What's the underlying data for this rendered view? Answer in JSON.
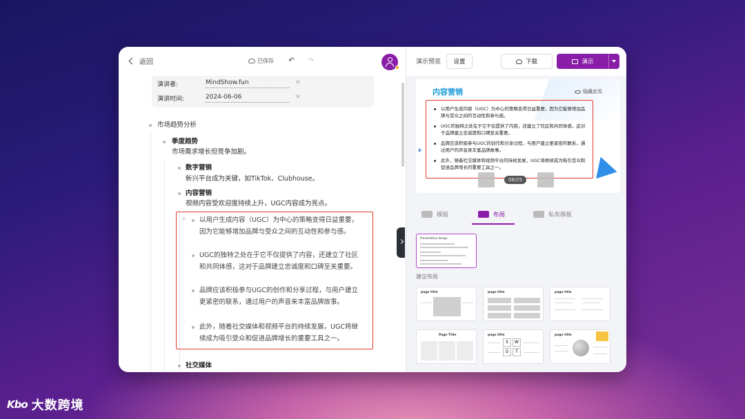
{
  "topbar": {
    "back_label": "返回",
    "saved_label": "已保存"
  },
  "meta": {
    "presenter_key": "演讲者:",
    "presenter_value": "MindShow.fun",
    "time_key": "演讲时间:",
    "time_value": "2024-06-06"
  },
  "outline": {
    "section": "市场趋势分析",
    "seasonal_title": "季度趋势",
    "seasonal_desc": "市场需求增长但竞争加剧。",
    "digital_title": "数字营销",
    "digital_desc": "新兴平台成为关键，如TikTok、Clubhouse。",
    "content_title": "内容营销",
    "content_desc": "视频内容受欢迎度持续上升，UGC内容成为亮点。",
    "paragraphs": [
      "以用户生成内容（UGC）为中心的策略变得日益重要，因为它能够增加品牌与受众之间的互动性和参与感。",
      "UGC的独特之处在于它不仅提供了内容，还建立了社区和共同体感，这对于品牌建立忠诚度和口碑至关重要。",
      "品牌应该积极参与UGC的创作和分享过程，与用户建立更紧密的联系，通过用户的声音来丰富品牌故事。",
      "此外，随着社交媒体和视频平台的持续发展，UGC将继续成为吸引受众和促进品牌增长的重要工具之一。"
    ],
    "next_title": "社交媒体"
  },
  "right": {
    "preview_label": "演示预览",
    "settings_label": "设置",
    "download_label": "下载",
    "present_label": "演示",
    "slide": {
      "title": "内容营销",
      "hide_label": "隐藏此页",
      "items": [
        "以用户生成内容（UGC）为中心的策略变得日益重要，因为它能够增加品牌与受众之间的互动性和参与感。",
        "UGC的独特之处在于它不仅提供了内容，还建立了社区和共同体感，这对于品牌建立忠诚度和口碑至关重要。",
        "品牌应该积极参与UGC的创作和分享过程，与用户建立更紧密的联系，通过用户的声音来丰富品牌故事。",
        "此外，随着社交媒体和视频平台的持续发展，UGC将继续成为吸引受众和促进品牌增长的重要工具之一。"
      ],
      "page_indicator": "08/25"
    },
    "tabs": [
      "模版",
      "布局",
      "私有模板"
    ],
    "current_layout_title": "Presentation design",
    "suggest_label": "建议布局",
    "thumb_titles": [
      "page title",
      "page title",
      "page title",
      "Page Title",
      "page title",
      "page title"
    ],
    "swot": [
      "S",
      "W",
      "O",
      "T"
    ]
  },
  "watermark": {
    "mark": "Kbo",
    "text": "大数跨境"
  },
  "colors": {
    "accent": "#8a1da8",
    "highlight": "#e0392b",
    "slide_title": "#1a9bd8"
  }
}
